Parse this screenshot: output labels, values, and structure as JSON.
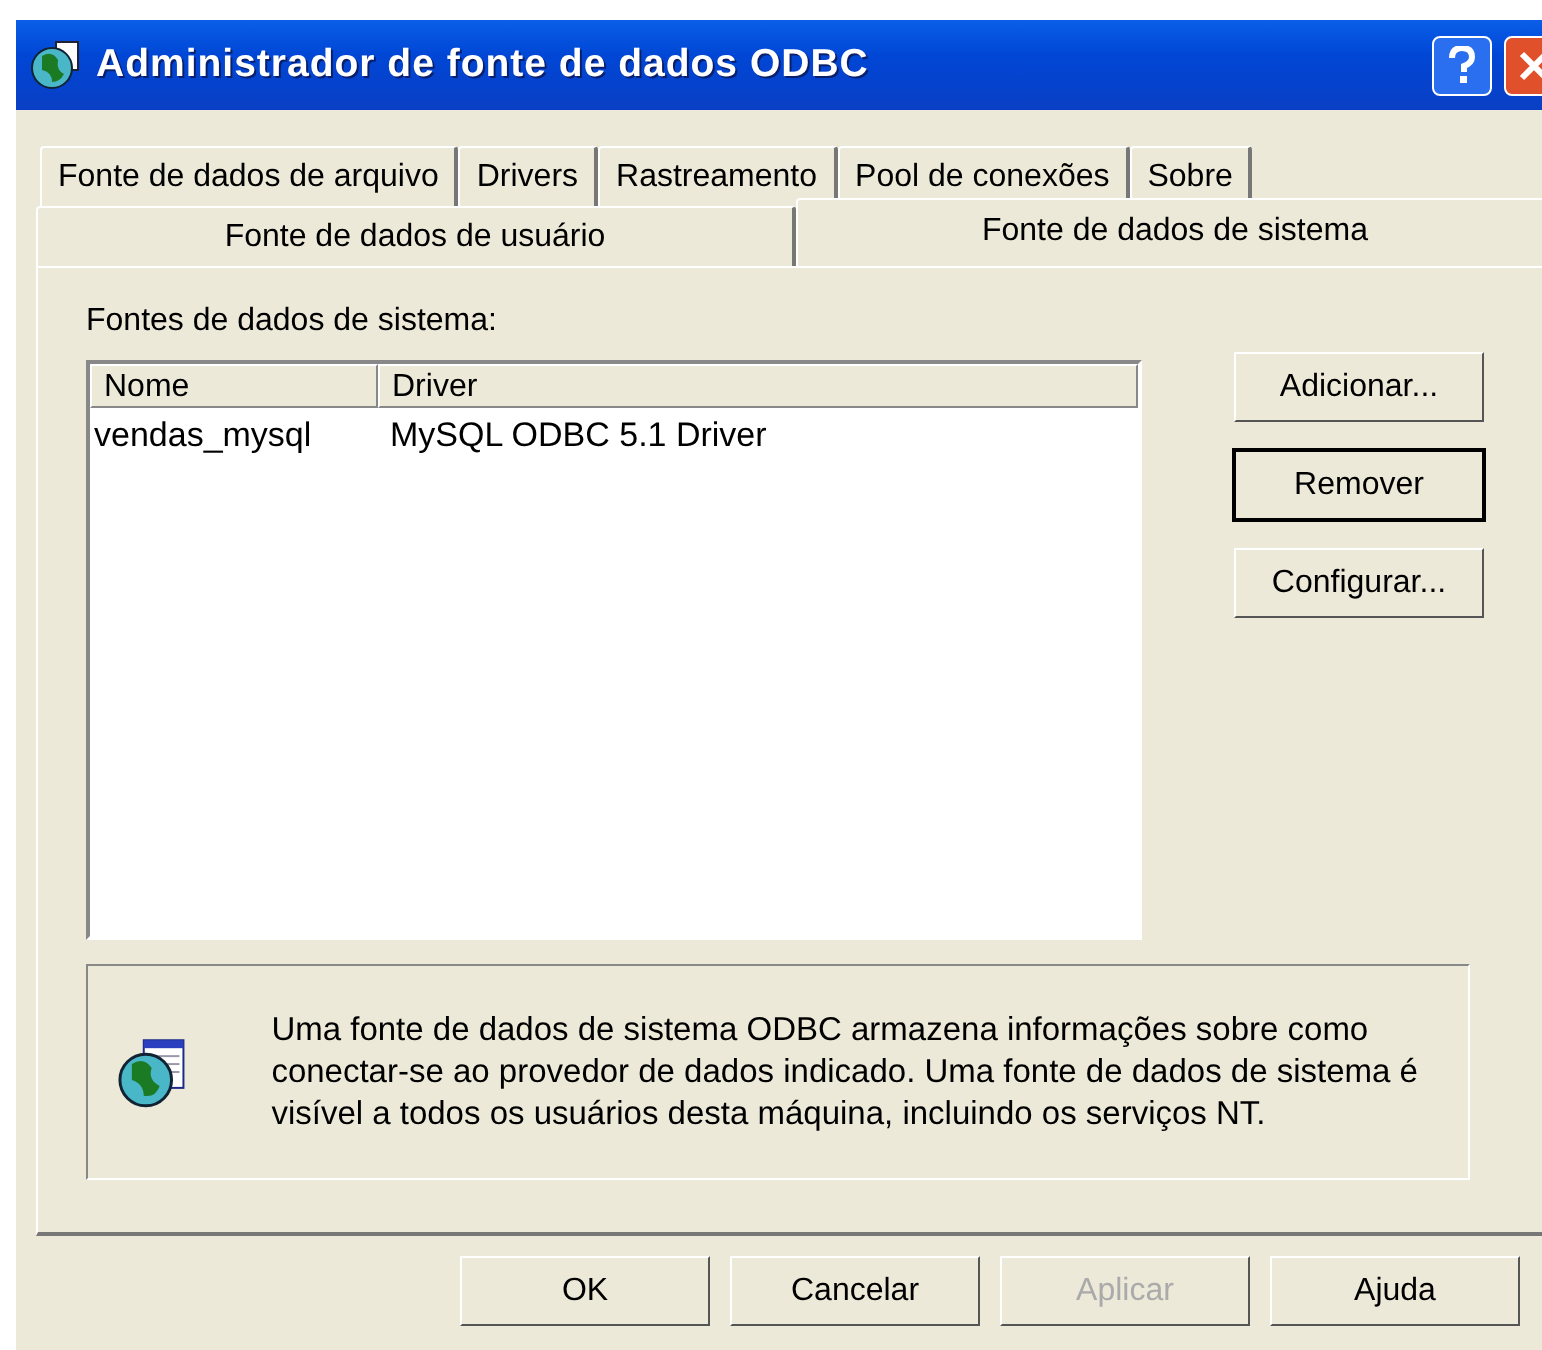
{
  "window": {
    "title": "Administrador de fonte de dados ODBC"
  },
  "tab_rows": [
    [
      {
        "label": "Fonte de dados de arquivo",
        "selected": false
      },
      {
        "label": "Drivers",
        "selected": false
      },
      {
        "label": "Rastreamento",
        "selected": false
      },
      {
        "label": "Pool de conexões",
        "selected": false
      },
      {
        "label": "Sobre",
        "selected": false
      }
    ],
    [
      {
        "label": "Fonte de dados de usuário",
        "selected": false
      },
      {
        "label": "Fonte de dados de sistema",
        "selected": true
      }
    ]
  ],
  "list_label": "Fontes de dados de sistema:",
  "table": {
    "columns": [
      "Nome",
      "Driver"
    ],
    "rows": [
      [
        "vendas_mysql",
        "MySQL ODBC 5.1 Driver"
      ]
    ]
  },
  "side_buttons": [
    {
      "label": "Adicionar...",
      "default": false
    },
    {
      "label": "Remover",
      "default": true
    },
    {
      "label": "Configurar...",
      "default": false
    }
  ],
  "info": "Uma fonte de dados de sistema ODBC armazena informações sobre como conectar-se ao provedor de dados indicado. Uma fonte de dados de sistema é visível a todos os usuários desta máquina, incluindo os serviços NT.",
  "buttons": [
    {
      "label": "OK",
      "disabled": false
    },
    {
      "label": "Cancelar",
      "disabled": false
    },
    {
      "label": "Aplicar",
      "disabled": true
    },
    {
      "label": "Ajuda",
      "disabled": false
    }
  ]
}
